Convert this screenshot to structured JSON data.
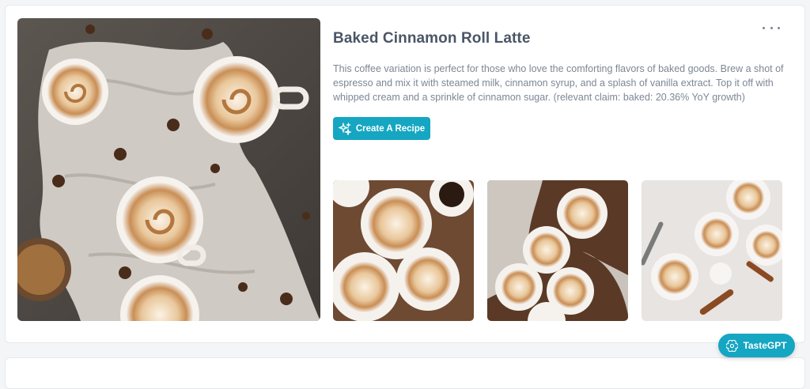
{
  "recipe": {
    "title": "Baked Cinnamon Roll Latte",
    "description": "This coffee variation is perfect for those who love the comforting flavors of baked goods. Brew a shot of espresso and mix it with steamed milk, cinnamon syrup, and a splash of vanilla extract. Top it off with whipped cream and a sprinkle of cinnamon sugar. (relevant claim: baked: 20.36% YoY growth)",
    "create_button_label": "Create A Recipe",
    "hero_image_alt": "Overhead view of cinnamon roll lattes on a cloth with star anise",
    "thumbnails": [
      {
        "alt": "Cinnamon swirl lattes on saucers with espresso cup"
      },
      {
        "alt": "Latte art cups on a wooden board with linen"
      },
      {
        "alt": "Cinnamon lattes on a white surface with cinnamon sticks"
      }
    ]
  },
  "assistant": {
    "label": "TasteGPT"
  },
  "colors": {
    "accent": "#15a6c2",
    "title": "#4a5666",
    "body_text": "#7d8794"
  },
  "icons": {
    "more": "more-horizontal-icon",
    "sparkle": "sparkle-icon",
    "assistant": "openai-icon"
  }
}
